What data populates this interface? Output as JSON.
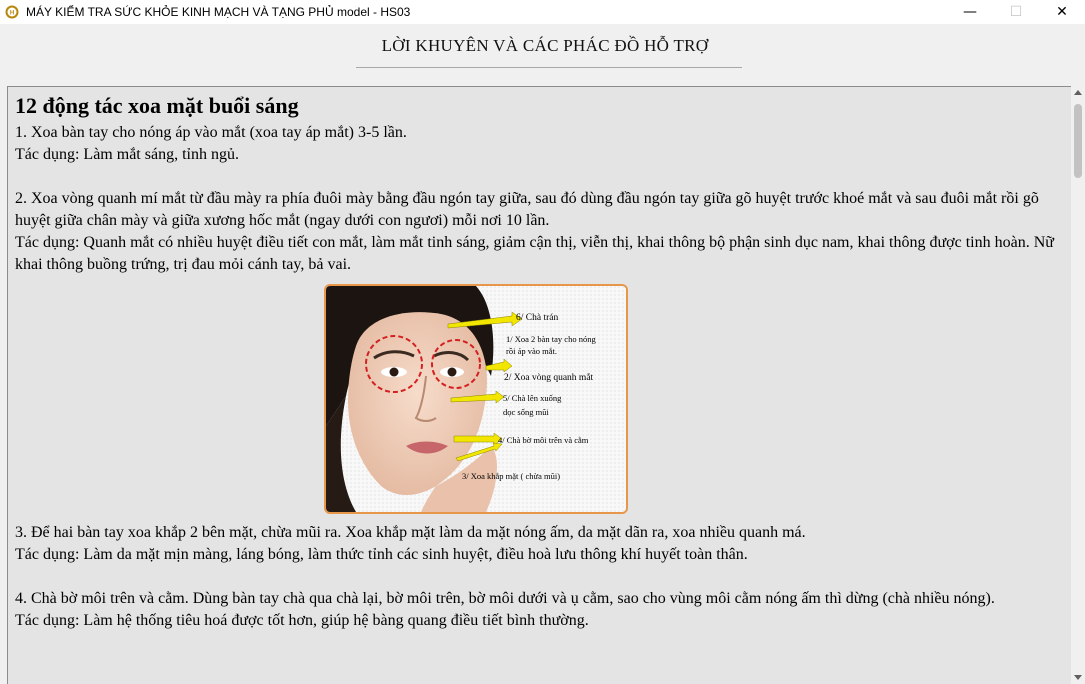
{
  "window": {
    "title": "MÁY KIỂM TRA SỨC KHỎE KINH MẠCH VÀ TẠNG PHỦ   model - HS03",
    "icon": "app-logo-icon",
    "minimize": "—",
    "maximize": "☐",
    "close": "✕"
  },
  "header": {
    "title": "LỜI KHUYÊN VÀ CÁC PHÁC ĐỒ HỖ TRỢ"
  },
  "article": {
    "heading": "12 động tác xoa mặt buổi sáng",
    "p1": "1. Xoa bàn tay cho nóng áp vào mắt (xoa tay áp mắt) 3-5 lần.",
    "p1_effect": "Tác dụng: Làm mắt sáng, tỉnh ngủ.",
    "p2": "2. Xoa vòng quanh mí mắt từ đầu mày ra phía đuôi mày bằng đầu ngón tay giữa, sau đó dùng đầu ngón tay giữa gõ huyệt trước khoé mắt và sau đuôi mắt rồi gõ huyệt giữa chân mày và giữa xương hốc mắt (ngay dưới con ngươi) mỗi nơi 10 lần.",
    "p2_effect": "Tác dụng: Quanh mắt có nhiều huyệt điều tiết con mắt, làm mắt tinh sáng, giảm cận thị, viễn thị, khai thông bộ phận sinh dục nam, khai thông được tinh hoàn. Nữ khai thông buồng trứng, trị đau mỏi cánh tay, bả vai.",
    "figure": {
      "label_6": "6/ Chà trán",
      "label_1a": "1/ Xoa 2 bàn tay cho nóng",
      "label_1b": "rồi áp vào mắt.",
      "label_2": "2/ Xoa vòng quanh mắt",
      "label_5a": "5/ Chà lên xuống",
      "label_5b": "dọc sống mũi",
      "label_4": "4/ Chà bờ môi trên và cằm",
      "label_3": "3/ Xoa khắp mặt ( chừa mũi)"
    },
    "p3": "3. Để hai bàn tay xoa khắp 2 bên mặt, chừa mũi ra. Xoa khắp mặt làm da mặt nóng ấm, da mặt dãn ra, xoa nhiều quanh má.",
    "p3_effect": "Tác dụng: Làm da mặt mịn màng, láng bóng, làm thức tỉnh các sinh huyệt, điều hoà lưu thông khí huyết toàn thân.",
    "p4": "4. Chà bờ môi trên và cằm. Dùng bàn tay chà qua chà lại, bờ môi trên, bờ môi dưới và ụ cằm, sao cho vùng môi cằm nóng ấm thì dừng (chà nhiều nóng).",
    "p4_effect": "Tác dụng: Làm hệ thống tiêu hoá được tốt hơn, giúp hệ bàng quang điều tiết bình thường."
  },
  "colors": {
    "figure_border": "#e8964a",
    "arrow_yellow": "#f2e600",
    "circle_red": "#d42020"
  }
}
